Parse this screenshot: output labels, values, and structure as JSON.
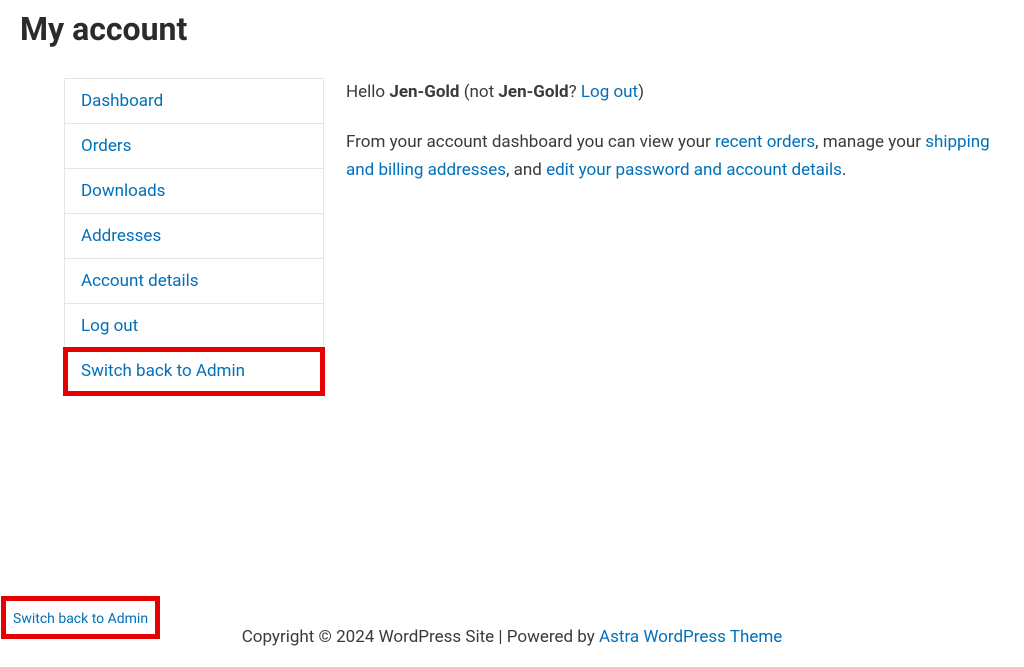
{
  "page_title": "My account",
  "nav": {
    "items": [
      {
        "label": "Dashboard"
      },
      {
        "label": "Orders"
      },
      {
        "label": "Downloads"
      },
      {
        "label": "Addresses"
      },
      {
        "label": "Account details"
      },
      {
        "label": "Log out"
      },
      {
        "label": "Switch back to Admin"
      }
    ]
  },
  "greeting": {
    "prefix": "Hello ",
    "username": "Jen-Gold",
    "not_open": " (not ",
    "not_username": "Jen-Gold",
    "question": "? ",
    "logout_link": "Log out",
    "close_paren": ")"
  },
  "dashboard_text": {
    "line1": "From your account dashboard you can view your ",
    "recent_orders": "recent orders",
    "line2": ", manage your ",
    "shipping": "shipping and billing addresses",
    "line3": ", and ",
    "edit_details": "edit your password and account details",
    "period": "."
  },
  "footer": {
    "copyright": "Copyright © 2024 WordPress Site | Powered by ",
    "theme_link": "Astra WordPress Theme"
  },
  "footer_switch": "Switch back to Admin"
}
